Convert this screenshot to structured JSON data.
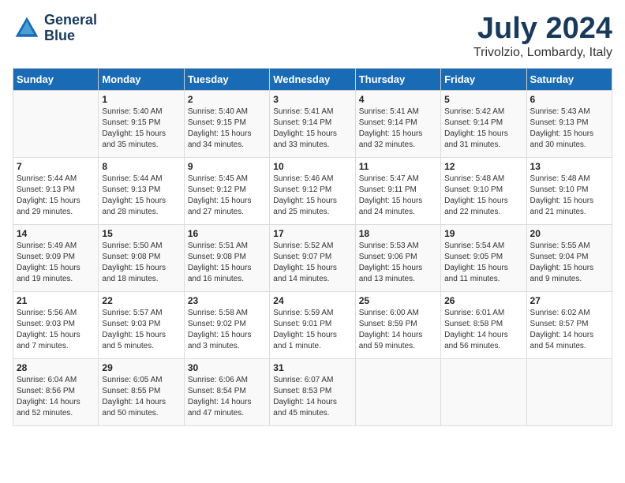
{
  "header": {
    "logo_line1": "General",
    "logo_line2": "Blue",
    "month_year": "July 2024",
    "location": "Trivolzio, Lombardy, Italy"
  },
  "days_of_week": [
    "Sunday",
    "Monday",
    "Tuesday",
    "Wednesday",
    "Thursday",
    "Friday",
    "Saturday"
  ],
  "weeks": [
    [
      {
        "day": "",
        "content": ""
      },
      {
        "day": "1",
        "content": "Sunrise: 5:40 AM\nSunset: 9:15 PM\nDaylight: 15 hours\nand 35 minutes."
      },
      {
        "day": "2",
        "content": "Sunrise: 5:40 AM\nSunset: 9:15 PM\nDaylight: 15 hours\nand 34 minutes."
      },
      {
        "day": "3",
        "content": "Sunrise: 5:41 AM\nSunset: 9:14 PM\nDaylight: 15 hours\nand 33 minutes."
      },
      {
        "day": "4",
        "content": "Sunrise: 5:41 AM\nSunset: 9:14 PM\nDaylight: 15 hours\nand 32 minutes."
      },
      {
        "day": "5",
        "content": "Sunrise: 5:42 AM\nSunset: 9:14 PM\nDaylight: 15 hours\nand 31 minutes."
      },
      {
        "day": "6",
        "content": "Sunrise: 5:43 AM\nSunset: 9:13 PM\nDaylight: 15 hours\nand 30 minutes."
      }
    ],
    [
      {
        "day": "7",
        "content": "Sunrise: 5:44 AM\nSunset: 9:13 PM\nDaylight: 15 hours\nand 29 minutes."
      },
      {
        "day": "8",
        "content": "Sunrise: 5:44 AM\nSunset: 9:13 PM\nDaylight: 15 hours\nand 28 minutes."
      },
      {
        "day": "9",
        "content": "Sunrise: 5:45 AM\nSunset: 9:12 PM\nDaylight: 15 hours\nand 27 minutes."
      },
      {
        "day": "10",
        "content": "Sunrise: 5:46 AM\nSunset: 9:12 PM\nDaylight: 15 hours\nand 25 minutes."
      },
      {
        "day": "11",
        "content": "Sunrise: 5:47 AM\nSunset: 9:11 PM\nDaylight: 15 hours\nand 24 minutes."
      },
      {
        "day": "12",
        "content": "Sunrise: 5:48 AM\nSunset: 9:10 PM\nDaylight: 15 hours\nand 22 minutes."
      },
      {
        "day": "13",
        "content": "Sunrise: 5:48 AM\nSunset: 9:10 PM\nDaylight: 15 hours\nand 21 minutes."
      }
    ],
    [
      {
        "day": "14",
        "content": "Sunrise: 5:49 AM\nSunset: 9:09 PM\nDaylight: 15 hours\nand 19 minutes."
      },
      {
        "day": "15",
        "content": "Sunrise: 5:50 AM\nSunset: 9:08 PM\nDaylight: 15 hours\nand 18 minutes."
      },
      {
        "day": "16",
        "content": "Sunrise: 5:51 AM\nSunset: 9:08 PM\nDaylight: 15 hours\nand 16 minutes."
      },
      {
        "day": "17",
        "content": "Sunrise: 5:52 AM\nSunset: 9:07 PM\nDaylight: 15 hours\nand 14 minutes."
      },
      {
        "day": "18",
        "content": "Sunrise: 5:53 AM\nSunset: 9:06 PM\nDaylight: 15 hours\nand 13 minutes."
      },
      {
        "day": "19",
        "content": "Sunrise: 5:54 AM\nSunset: 9:05 PM\nDaylight: 15 hours\nand 11 minutes."
      },
      {
        "day": "20",
        "content": "Sunrise: 5:55 AM\nSunset: 9:04 PM\nDaylight: 15 hours\nand 9 minutes."
      }
    ],
    [
      {
        "day": "21",
        "content": "Sunrise: 5:56 AM\nSunset: 9:03 PM\nDaylight: 15 hours\nand 7 minutes."
      },
      {
        "day": "22",
        "content": "Sunrise: 5:57 AM\nSunset: 9:03 PM\nDaylight: 15 hours\nand 5 minutes."
      },
      {
        "day": "23",
        "content": "Sunrise: 5:58 AM\nSunset: 9:02 PM\nDaylight: 15 hours\nand 3 minutes."
      },
      {
        "day": "24",
        "content": "Sunrise: 5:59 AM\nSunset: 9:01 PM\nDaylight: 15 hours\nand 1 minute."
      },
      {
        "day": "25",
        "content": "Sunrise: 6:00 AM\nSunset: 8:59 PM\nDaylight: 14 hours\nand 59 minutes."
      },
      {
        "day": "26",
        "content": "Sunrise: 6:01 AM\nSunset: 8:58 PM\nDaylight: 14 hours\nand 56 minutes."
      },
      {
        "day": "27",
        "content": "Sunrise: 6:02 AM\nSunset: 8:57 PM\nDaylight: 14 hours\nand 54 minutes."
      }
    ],
    [
      {
        "day": "28",
        "content": "Sunrise: 6:04 AM\nSunset: 8:56 PM\nDaylight: 14 hours\nand 52 minutes."
      },
      {
        "day": "29",
        "content": "Sunrise: 6:05 AM\nSunset: 8:55 PM\nDaylight: 14 hours\nand 50 minutes."
      },
      {
        "day": "30",
        "content": "Sunrise: 6:06 AM\nSunset: 8:54 PM\nDaylight: 14 hours\nand 47 minutes."
      },
      {
        "day": "31",
        "content": "Sunrise: 6:07 AM\nSunset: 8:53 PM\nDaylight: 14 hours\nand 45 minutes."
      },
      {
        "day": "",
        "content": ""
      },
      {
        "day": "",
        "content": ""
      },
      {
        "day": "",
        "content": ""
      }
    ]
  ]
}
